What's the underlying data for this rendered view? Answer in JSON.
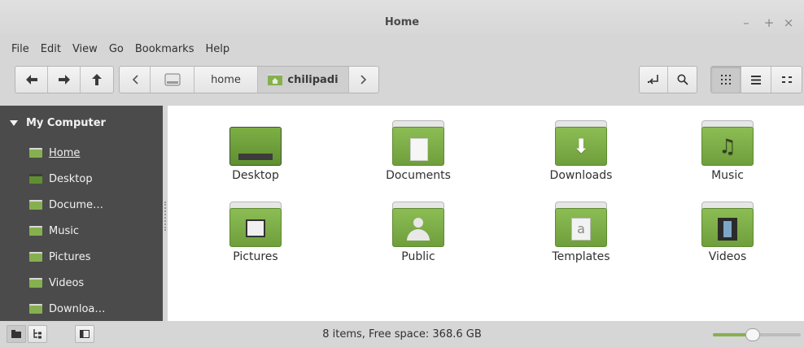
{
  "window": {
    "title": "Home",
    "controls": {
      "minimize": "–",
      "maximize": "+",
      "close": "×"
    }
  },
  "menubar": [
    "File",
    "Edit",
    "View",
    "Go",
    "Bookmarks",
    "Help"
  ],
  "toolbar": {
    "nav": {
      "back_icon": "left-arrow-icon",
      "forward_icon": "right-arrow-icon",
      "up_icon": "up-arrow-icon"
    },
    "path": {
      "prev_icon": "chevron-left-icon",
      "root_icon": "drive-icon",
      "segments": [
        "home",
        "chilipadi"
      ],
      "active_segment": "chilipadi",
      "next_icon": "chevron-right-icon"
    },
    "toggle_location_icon": "location-toggle-icon",
    "search_icon": "search-icon",
    "view_modes": [
      "icon-view",
      "list-view",
      "compact-view"
    ],
    "active_view": "icon-view"
  },
  "sidebar": {
    "section": "My Computer",
    "items": [
      {
        "label": "Home",
        "selected": true
      },
      {
        "label": "Desktop",
        "selected": false
      },
      {
        "label": "Docume…",
        "selected": false
      },
      {
        "label": "Music",
        "selected": false
      },
      {
        "label": "Pictures",
        "selected": false
      },
      {
        "label": "Videos",
        "selected": false
      },
      {
        "label": "Downloa…",
        "selected": false
      }
    ]
  },
  "files": [
    {
      "name": "Desktop",
      "emblem": "desktop-icon"
    },
    {
      "name": "Documents",
      "emblem": "document-icon"
    },
    {
      "name": "Downloads",
      "emblem": "download-arrow-icon"
    },
    {
      "name": "Music",
      "emblem": "music-note-icon"
    },
    {
      "name": "Pictures",
      "emblem": "photo-icon"
    },
    {
      "name": "Public",
      "emblem": "person-icon"
    },
    {
      "name": "Templates",
      "emblem": "template-icon"
    },
    {
      "name": "Videos",
      "emblem": "film-icon"
    }
  ],
  "statusbar": {
    "text": "8 items, Free space: 368.6 GB",
    "zoom_level": 0.45
  },
  "colors": {
    "folder_green": "#86b04f",
    "sidebar_bg": "#4b4b4b",
    "chrome_bg": "#d6d6d6"
  }
}
